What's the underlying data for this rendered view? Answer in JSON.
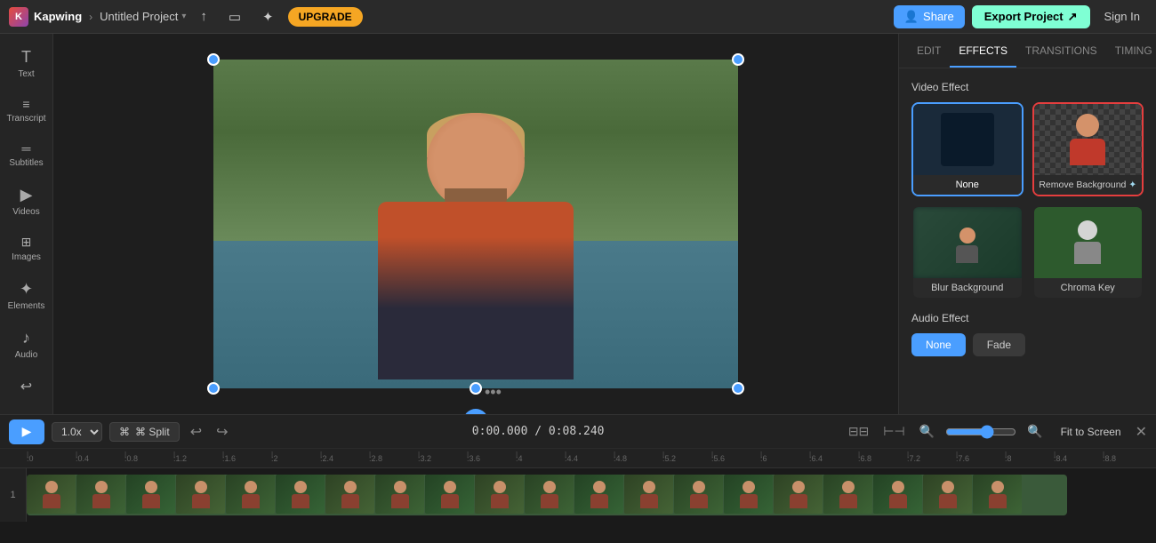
{
  "topbar": {
    "logo_text": "Kapwing",
    "breadcrumb_sep": "›",
    "project_name": "Untitled Project",
    "project_chevron": "▾",
    "upload_icon": "↑",
    "monitor_icon": "▭",
    "light_icon": "✦",
    "upgrade_label": "UPGRADE",
    "share_icon": "👤+",
    "share_label": "Share",
    "export_label": "Export Project",
    "export_icon": "↗",
    "signin_label": "Sign In"
  },
  "sidebar": {
    "items": [
      {
        "id": "text",
        "icon": "T",
        "label": "Text"
      },
      {
        "id": "transcript",
        "icon": "≡",
        "label": "Transcript"
      },
      {
        "id": "subtitles",
        "icon": "—",
        "label": "Subtitles"
      },
      {
        "id": "videos",
        "icon": "▶",
        "label": "Videos"
      },
      {
        "id": "images",
        "icon": "⊞",
        "label": "Images"
      },
      {
        "id": "elements",
        "icon": "✦",
        "label": "Elements"
      },
      {
        "id": "audio",
        "icon": "♪",
        "label": "Audio"
      }
    ],
    "undo_icon": "↩"
  },
  "panel": {
    "tabs": [
      {
        "id": "edit",
        "label": "EDIT",
        "active": false
      },
      {
        "id": "effects",
        "label": "EFFECTS",
        "active": true
      },
      {
        "id": "transitions",
        "label": "TRANSITIONS",
        "active": false
      },
      {
        "id": "timing",
        "label": "TIMING",
        "active": false
      }
    ],
    "video_effect_label": "Video Effect",
    "effects": [
      {
        "id": "none",
        "label": "None",
        "active_class": "active-none"
      },
      {
        "id": "remove-bg",
        "label": "Remove Background ✦",
        "active_class": "active-remove"
      },
      {
        "id": "blur-bg",
        "label": "Blur Background",
        "active_class": ""
      },
      {
        "id": "chroma-key",
        "label": "Chroma Key",
        "active_class": ""
      }
    ],
    "audio_effect_label": "Audio Effect",
    "audio_buttons": [
      {
        "id": "none",
        "label": "None",
        "active": true
      },
      {
        "id": "fade",
        "label": "Fade",
        "active": false
      }
    ]
  },
  "timeline": {
    "play_icon": "▶",
    "speed_label": "1.0x",
    "split_label": "⌘ Split",
    "undo_icon": "↩",
    "redo_icon": "↪",
    "timestamp": "0:00.000 / 0:08.240",
    "fit_screen_label": "Fit to Screen",
    "close_icon": "✕",
    "ruler_marks": [
      ":0",
      ":0.4",
      ":0.8",
      ":1.2",
      ":1.6",
      ":2",
      ":2.4",
      ":2.8",
      ":3.2",
      ":3.6",
      ":4",
      ":4.4",
      ":4.8",
      ":5.2",
      ":5.6",
      ":6",
      ":6.4",
      ":6.8",
      ":7.2",
      ":7.6",
      ":8",
      ":8.4",
      ":8.8"
    ],
    "track_number": "1"
  }
}
